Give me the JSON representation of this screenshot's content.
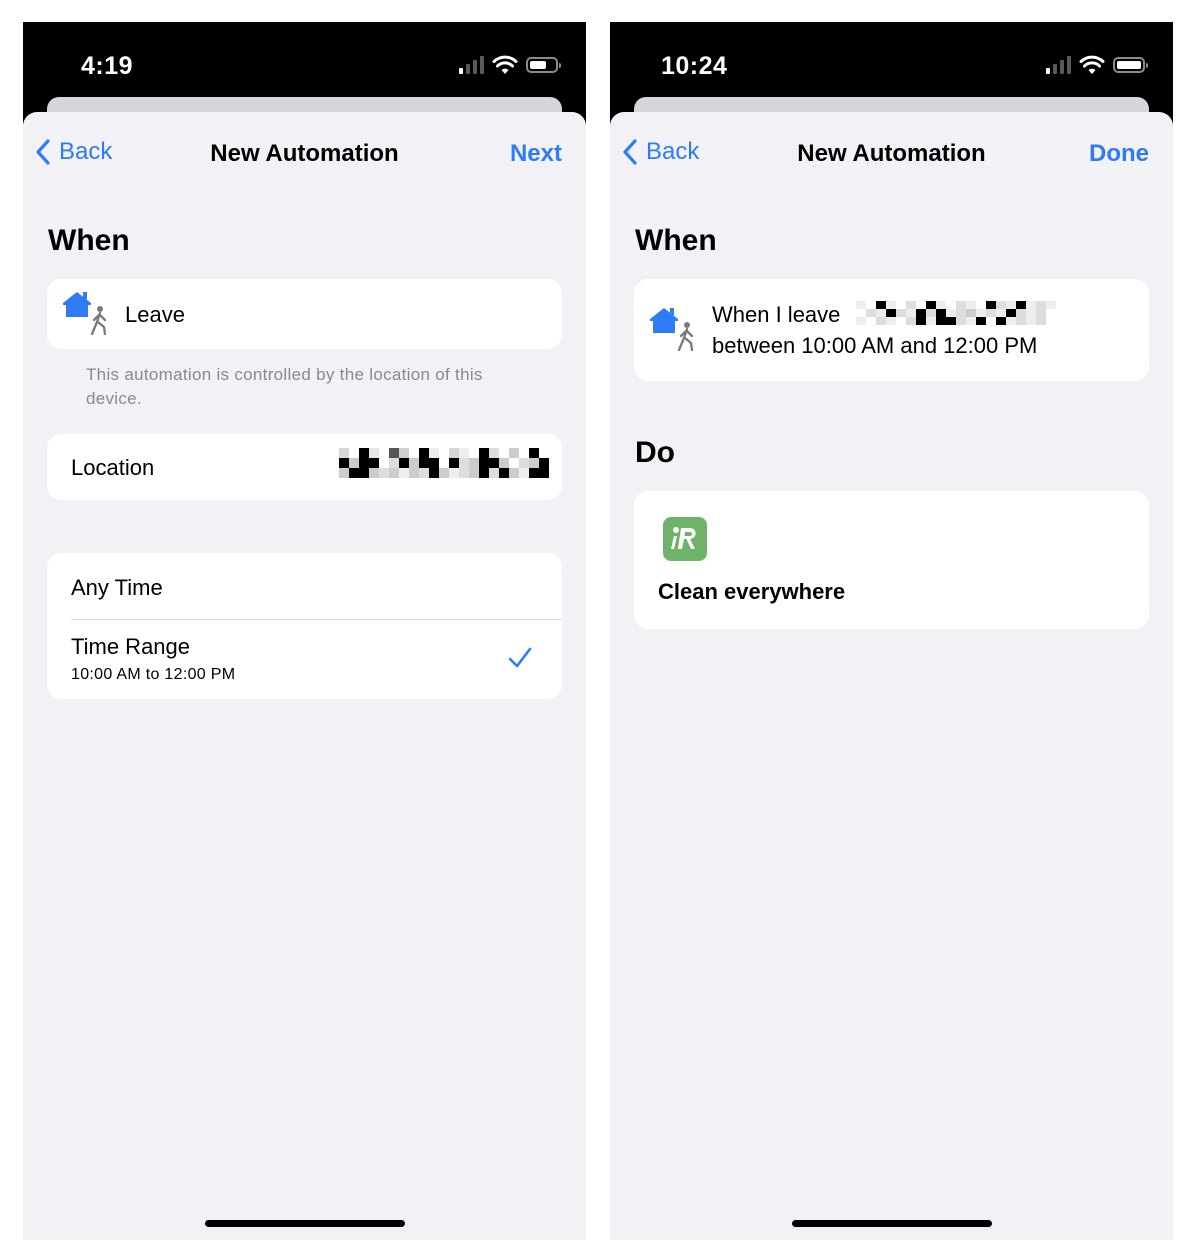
{
  "left_screen": {
    "status": {
      "time": "4:19"
    },
    "nav": {
      "back_label": "Back",
      "title": "New Automation",
      "action_label": "Next"
    },
    "when_header": "When",
    "trigger": {
      "label": "Leave",
      "icon": "home-leave-icon"
    },
    "footnote": "This automation is controlled by the location of this device.",
    "location": {
      "label": "Location",
      "value_redacted": true
    },
    "time_options": [
      {
        "label": "Any Time",
        "sublabel": "",
        "selected": false
      },
      {
        "label": "Time Range",
        "sublabel": "10:00 AM to 12:00 PM",
        "selected": true
      }
    ]
  },
  "right_screen": {
    "status": {
      "time": "10:24"
    },
    "nav": {
      "back_label": "Back",
      "title": "New Automation",
      "action_label": "Done"
    },
    "when_header": "When",
    "summary": {
      "line1": "When I leave",
      "line2": "between 10:00 AM and 12:00 PM",
      "icon": "home-leave-icon"
    },
    "do_header": "Do",
    "action": {
      "label": "Clean everywhere",
      "app_icon": "irobot-app-icon",
      "app_color": "#6fb36a"
    }
  },
  "colors": {
    "accent": "#2f7bf5",
    "background": "#f2f1f6",
    "card": "#ffffff"
  }
}
